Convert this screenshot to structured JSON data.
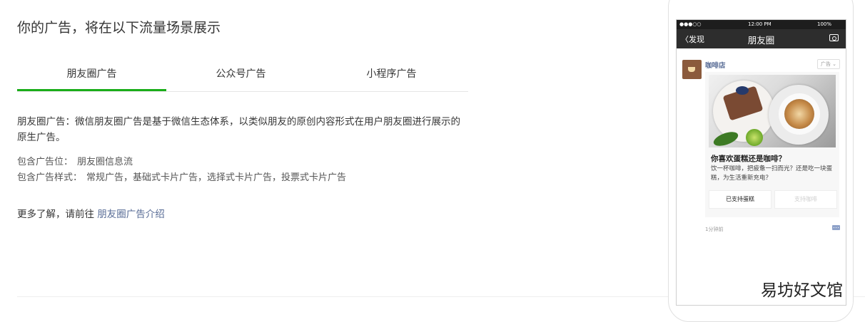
{
  "section_title": "你的广告，将在以下流量场景展示",
  "tabs": [
    {
      "label": "朋友圈广告",
      "active": true
    },
    {
      "label": "公众号广告",
      "active": false
    },
    {
      "label": "小程序广告",
      "active": false
    }
  ],
  "accent_color": "#1aad19",
  "description": "朋友圈广告：微信朋友圈广告是基于微信生态体系，以类似朋友的原创内容形式在用户朋友圈进行展示的原生广告。",
  "placements": {
    "label": "包含广告位：",
    "value": "朋友圈信息流"
  },
  "styles": {
    "label": "包含广告样式：",
    "value": "常规广告，基础式卡片广告，选择式卡片广告，投票式卡片广告"
  },
  "learn_more": {
    "prefix": "更多了解，请前往 ",
    "link": "朋友圈广告介绍"
  },
  "phone": {
    "status": {
      "signal": "●●●○○",
      "time": "12:00 PM",
      "battery": "100%"
    },
    "nav": {
      "back": "〈发现",
      "title": "朋友圈",
      "camera_icon": "camera-icon"
    },
    "post": {
      "name": "咖啡店",
      "ad_tag": "广告 ⌄",
      "question": "你喜欢蛋糕还是咖啡？",
      "text": "饮一杯咖啡，把疲惫一扫而光？还是吃一块蛋糕，为生活重新充电？",
      "option_a": "已支持蛋糕",
      "option_b": "支持咖啡",
      "time": "1分钟前"
    }
  },
  "watermark": "易坊好文馆"
}
